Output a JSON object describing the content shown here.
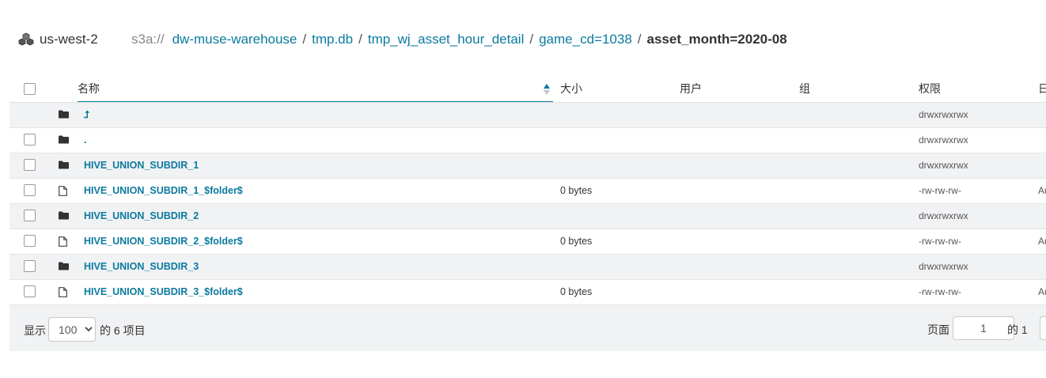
{
  "breadcrumb": {
    "region": "us-west-2",
    "scheme": "s3a://",
    "links": [
      "dw-muse-warehouse",
      "tmp.db",
      "tmp_wj_asset_hour_detail",
      "game_cd=1038"
    ],
    "separator": "/",
    "current": "asset_month=2020-08"
  },
  "table": {
    "columns": {
      "name": "名称",
      "size": "大小",
      "user": "用户",
      "group": "组",
      "permission": "权限",
      "date": "日"
    },
    "rows": [
      {
        "type": "folder",
        "name": "⮥",
        "size": "",
        "perm": "drwxrwxrwx",
        "extra": ""
      },
      {
        "type": "folder",
        "name": ".",
        "size": "",
        "perm": "drwxrwxrwx",
        "extra": ""
      },
      {
        "type": "folder",
        "name": "HIVE_UNION_SUBDIR_1",
        "size": "",
        "perm": "drwxrwxrwx",
        "extra": ""
      },
      {
        "type": "file",
        "name": "HIVE_UNION_SUBDIR_1_$folder$",
        "size": "0 bytes",
        "perm": "-rw-rw-rw-",
        "extra": "Au"
      },
      {
        "type": "folder",
        "name": "HIVE_UNION_SUBDIR_2",
        "size": "",
        "perm": "drwxrwxrwx",
        "extra": ""
      },
      {
        "type": "file",
        "name": "HIVE_UNION_SUBDIR_2_$folder$",
        "size": "0 bytes",
        "perm": "-rw-rw-rw-",
        "extra": "Au"
      },
      {
        "type": "folder",
        "name": "HIVE_UNION_SUBDIR_3",
        "size": "",
        "perm": "drwxrwxrwx",
        "extra": ""
      },
      {
        "type": "file",
        "name": "HIVE_UNION_SUBDIR_3_$folder$",
        "size": "0 bytes",
        "perm": "-rw-rw-rw-",
        "extra": "Au"
      }
    ]
  },
  "footer": {
    "show_label": "显示",
    "page_size": "100",
    "count_text": "的 6 项目",
    "page_label": "页面",
    "page_value": "1",
    "page_total": "的 1"
  },
  "colors": {
    "link": "#0b7a9e",
    "row_alt": "#f1f2f4"
  }
}
